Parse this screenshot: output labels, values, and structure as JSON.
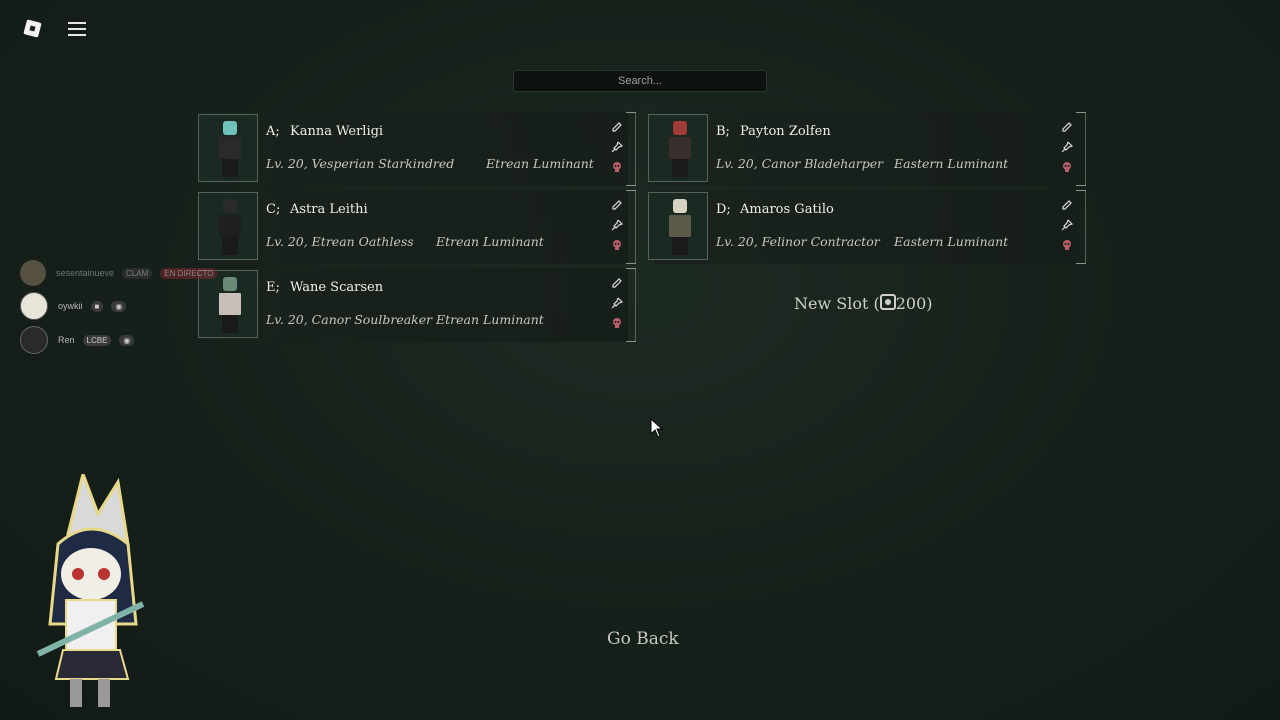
{
  "search": {
    "placeholder": "Search..."
  },
  "slots": [
    {
      "letter": "A;",
      "name": "Kanna Werligi",
      "sub": "Lv. 20, Vesperian Starkindred",
      "region": "Etrean Luminant",
      "hair": "#6fc2bb",
      "outfit": "#2a2a2a"
    },
    {
      "letter": "B;",
      "name": "Payton Zolfen",
      "sub": "Lv. 20, Canor Bladeharper",
      "region": "Eastern Luminant",
      "hair": "#a23a3a",
      "outfit": "#3a2f2f"
    },
    {
      "letter": "C;",
      "name": "Astra Leithi",
      "sub": "Lv. 20, Etrean Oathless",
      "region": "Etrean Luminant",
      "hair": "#2a2a2a",
      "outfit": "#1f1f1f"
    },
    {
      "letter": "D;",
      "name": "Amaros Gatilo",
      "sub": "Lv. 20, Felinor Contractor",
      "region": "Eastern Luminant",
      "hair": "#d8d2c2",
      "outfit": "#5b5a48"
    },
    {
      "letter": "E;",
      "name": "Wane Scarsen",
      "sub": "Lv. 20, Canor Soulbreaker",
      "region": "Etrean Luminant",
      "hair": "#6a8a78",
      "outfit": "#c8c0b8"
    }
  ],
  "new_slot": {
    "label_before": "New Slot (",
    "cost": "200",
    "label_after": ")"
  },
  "go_back": "Go Back",
  "overlay": [
    {
      "user": "sesentainueve",
      "badge": "CLAM",
      "badge2": "EN DIRECTO"
    },
    {
      "user": "oywkii"
    },
    {
      "user": "Ren",
      "badge": "LCBE"
    }
  ]
}
